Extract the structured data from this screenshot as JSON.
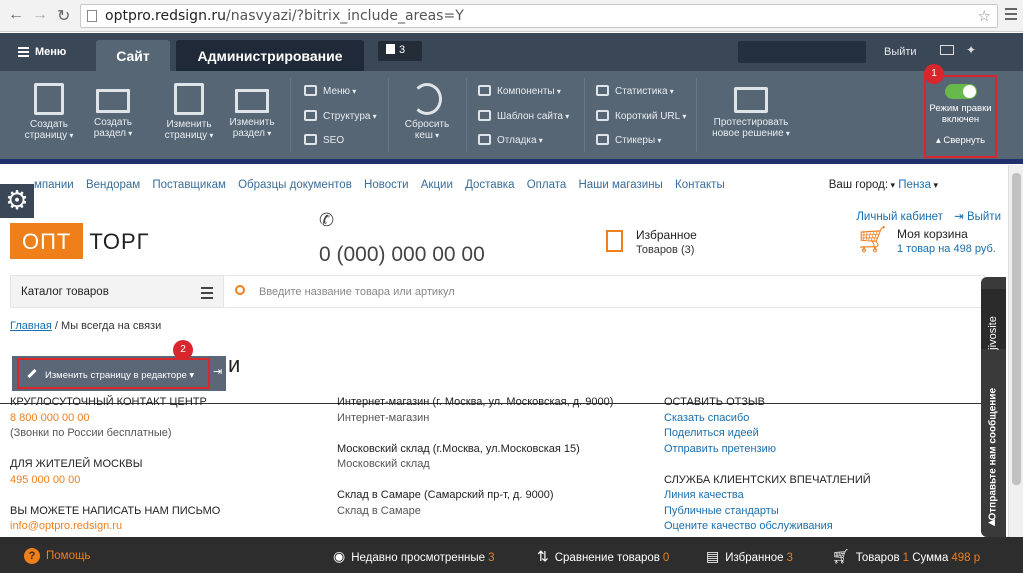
{
  "browser": {
    "url_host": "optpro.redsign.ru",
    "url_path": "/nasvyazi/?bitrix_include_areas=Y"
  },
  "admin": {
    "menu_label": "Меню",
    "tab_site": "Сайт",
    "tab_admin": "Администрирование",
    "notif_count": "3",
    "logout": "Выйти",
    "toolbar": [
      {
        "l1": "Создать",
        "l2": "страницу"
      },
      {
        "l1": "Создать",
        "l2": "раздел"
      },
      {
        "l1": "Изменить",
        "l2": "страницу"
      },
      {
        "l1": "Изменить",
        "l2": "раздел"
      },
      {
        "l1": "Сбросить",
        "l2": "кеш"
      },
      {
        "l1": "Протестировать",
        "l2": "новое решение"
      }
    ],
    "small_items": [
      "Меню",
      "Структура",
      "SEO",
      "Компоненты",
      "Шаблон сайта",
      "Отладка",
      "Статистика",
      "Короткий URL",
      "Стикеры"
    ],
    "edit_mode_l1": "Режим правки",
    "edit_mode_l2": "включен",
    "collapse": "Свернуть",
    "badge1": "1",
    "badge2": "2"
  },
  "topnav": {
    "items": [
      "мпании",
      "Вендорам",
      "Поставщикам",
      "Образцы документов",
      "Новости",
      "Акции",
      "Доставка",
      "Оплата",
      "Наши магазины",
      "Контакты"
    ],
    "city_label": "Ваш город:",
    "city": "Пенза"
  },
  "header": {
    "logo_opt": "ОПТ",
    "logo_torg": "ТОРГ",
    "phone": "0 (000) 000 00 00",
    "fav_title": "Избранное",
    "fav_sub": "Товаров (3)",
    "cabinet": "Личный кабинет",
    "logout": "Выйти",
    "cart_title": "Моя корзина",
    "cart_sub": "1 товар на 498 руб."
  },
  "catalog": {
    "label": "Каталог товаров",
    "search_placeholder": "Введите название товара или артикул"
  },
  "breadcrumb": {
    "home": "Главная",
    "sep": " / ",
    "current": "Мы всегда на связи"
  },
  "edit_page_btn": "Изменить страницу в редакторе",
  "h1_tail": "и",
  "contacts": {
    "col1": [
      {
        "t": "КРУГЛОСУТОЧНЫЙ КОНТАКТ ЦЕНТР",
        "c": "h"
      },
      {
        "t": "8 800 000 00 00",
        "c": "o"
      },
      {
        "t": "(Звонки по России бесплатные)",
        "c": "g"
      },
      {
        "t": "",
        "c": "h"
      },
      {
        "t": "ДЛЯ ЖИТЕЛЕЙ МОСКВЫ",
        "c": "h"
      },
      {
        "t": "495 000 00 00",
        "c": "o"
      },
      {
        "t": "",
        "c": "h"
      },
      {
        "t": "ВЫ МОЖЕТЕ НАПИСАТЬ НАМ ПИСЬМО",
        "c": "h"
      },
      {
        "t": "info@optpro.redsign.ru",
        "c": "o"
      }
    ],
    "col2": [
      {
        "t": "Интернет-магазин (г. Москва, ул. Московская, д. 9000)",
        "c": "h"
      },
      {
        "t": "Интернет-магазин",
        "c": "g"
      },
      {
        "t": "",
        "c": "h"
      },
      {
        "t": "Московский склад (г.Москва, ул.Московская 15)",
        "c": "h"
      },
      {
        "t": "Московский склад",
        "c": "g"
      },
      {
        "t": "",
        "c": "h"
      },
      {
        "t": "Склад в Самаре (Самарский пр-т, д. 9000)",
        "c": "h"
      },
      {
        "t": "Склад в Самаре",
        "c": "g"
      }
    ],
    "col3": [
      {
        "t": "ОСТАВИТЬ ОТЗЫВ",
        "c": "h"
      },
      {
        "t": "Сказать спасибо",
        "c": "l"
      },
      {
        "t": "Поделиться идеей",
        "c": "l"
      },
      {
        "t": "Отправить претензию",
        "c": "l"
      },
      {
        "t": "",
        "c": "h"
      },
      {
        "t": "СЛУЖБА КЛИЕНТСКИХ ВПЕЧАТЛЕНИЙ",
        "c": "h"
      },
      {
        "t": "Линия качества",
        "c": "l"
      },
      {
        "t": "Публичные стандарты",
        "c": "l"
      },
      {
        "t": "Оцените качество обслуживания",
        "c": "l"
      }
    ]
  },
  "jivo": {
    "brand": "jivosite",
    "cta": "Отправьте нам сообщение"
  },
  "bottombar": {
    "help": "Помощь",
    "recent": "Недавно просмотренные",
    "recent_count": "3",
    "compare": "Сравнение товаров",
    "compare_count": "0",
    "fav": "Избранное",
    "fav_count": "3",
    "goods": "Товаров",
    "goods_count": "1",
    "sum": "Сумма",
    "sum_value": "498 р"
  }
}
